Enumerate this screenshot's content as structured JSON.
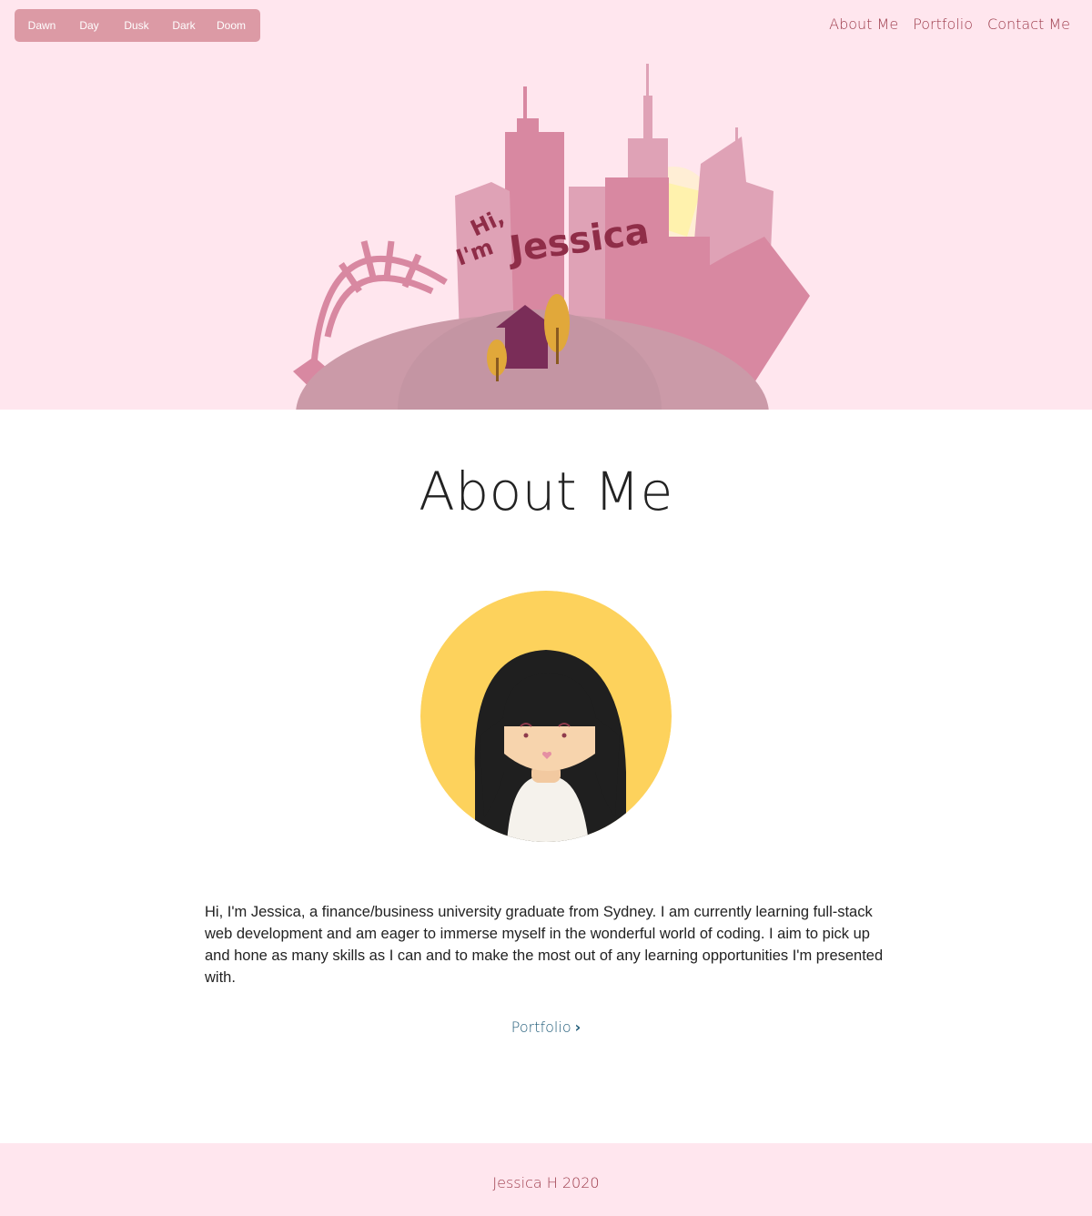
{
  "theme_switcher": {
    "options": [
      "Dawn",
      "Day",
      "Dusk",
      "Dark",
      "Doom"
    ]
  },
  "nav": {
    "items": [
      "About Me",
      "Portfolio",
      "Contact Me"
    ]
  },
  "hero": {
    "greeting_small": "Hi,",
    "greeting_im": "I'm",
    "greeting_name": "Jessica"
  },
  "about": {
    "title": "About Me",
    "bio": "Hi, I'm Jessica, a finance/business university graduate from Sydney. I am currently learning full-stack web development and am eager to immerse myself in the wonderful world of coding. I aim to pick up and hone as many skills as I can and to make the most out of any learning opportunities I'm presented with.",
    "portfolio_link": "Portfolio",
    "portfolio_icon": "chevron-right-icon"
  },
  "footer": {
    "text": "Jessica H 2020"
  },
  "colors": {
    "hero_bg": "#ffe6ee",
    "switcher_bg": "#dc9aa5",
    "nav_text": "#9c3b4a",
    "link_text": "#1f5b78",
    "avatar_bg": "#fdd25c"
  }
}
